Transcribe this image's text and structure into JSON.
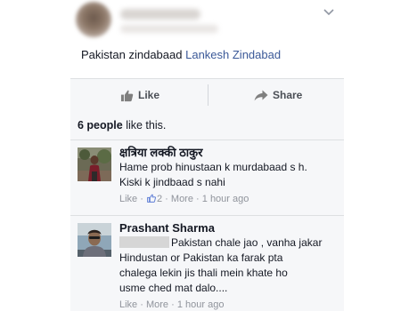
{
  "post": {
    "text": "Pakistan zindabaad",
    "mention": "Lankesh Zindabad"
  },
  "actions": {
    "like_label": "Like",
    "share_label": "Share"
  },
  "likes_summary": {
    "count_text": "6 people",
    "suffix": "like this."
  },
  "comments": [
    {
      "author": "क्षत्रिया लक्की ठाकुर",
      "lines": [
        "Hame prob hinustaan k murdabaad s h.",
        "Kiski k jindbaad s nahi"
      ],
      "like_label": "Like",
      "likes": "2",
      "more_label": "More",
      "time": "1 hour ago",
      "separator": "·"
    },
    {
      "author": "Prashant Sharma",
      "lines": [
        "Pakistan chale jao , vanha jakar",
        "Hindustan or Pakistan ka farak pta",
        "chalega lekin jis thali mein khate ho",
        "usme ched mat dalo...."
      ],
      "like_label": "Like",
      "more_label": "More",
      "time": "1 hour ago",
      "separator": "·"
    }
  ],
  "colors": {
    "link": "#3b5998",
    "meta": "#90949c",
    "panel": "#f6f7f9",
    "border": "#dddfe2"
  },
  "icons": [
    "chevron-down-icon",
    "thumbs-up-icon",
    "share-arrow-icon",
    "mini-thumbs-up-icon"
  ]
}
